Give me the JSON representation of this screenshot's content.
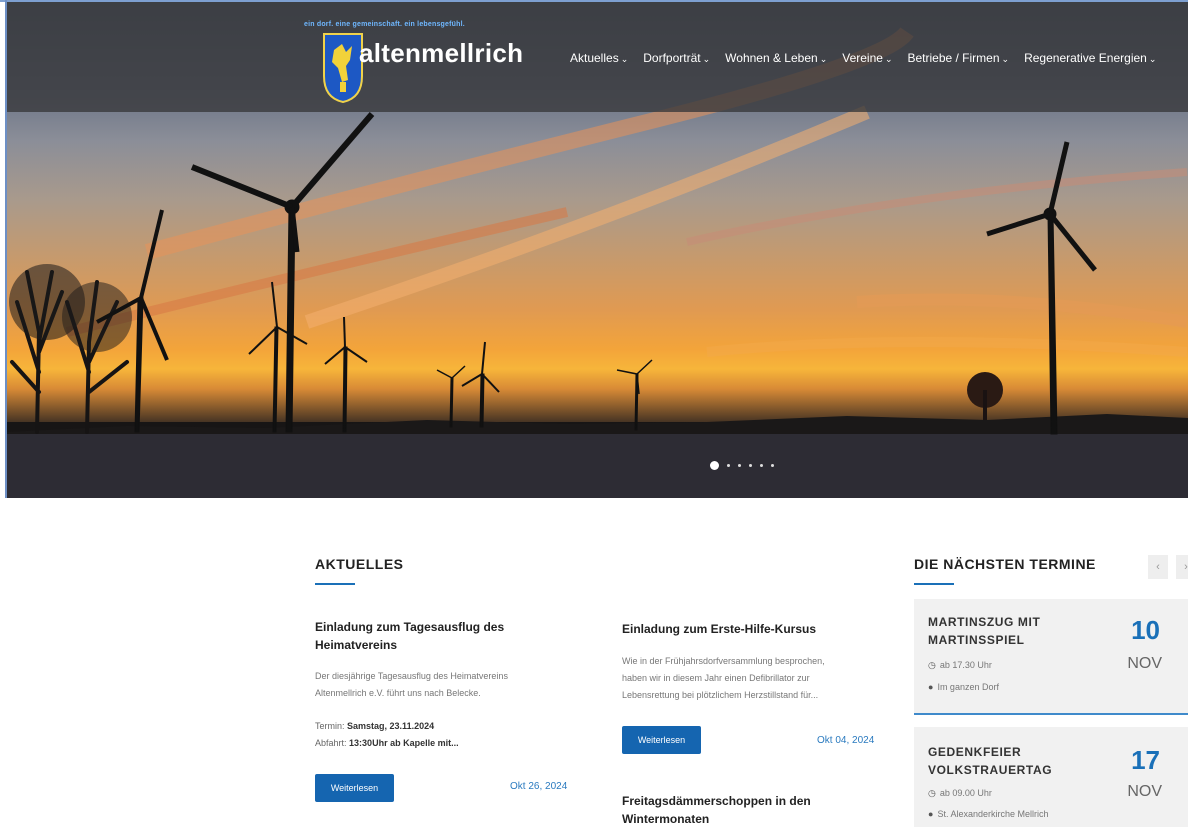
{
  "header": {
    "tagline": "ein dorf. eine gemeinschaft. ein lebensgefühl.",
    "brand": "altenmellrich",
    "nav": [
      {
        "label": "Aktuelles"
      },
      {
        "label": "Dorfporträt"
      },
      {
        "label": "Wohnen & Leben"
      },
      {
        "label": "Vereine"
      },
      {
        "label": "Betriebe / Firmen"
      },
      {
        "label": "Regenerative Energien"
      }
    ]
  },
  "slider": {
    "slide_count": 6,
    "active_index": 0
  },
  "aktuelles": {
    "title": "AKTUELLES",
    "articles": [
      {
        "title_line1": "Einladung zum Tagesausflug des",
        "title_line2": "Heimatvereins",
        "text_line1": "Der diesjährige Tagesausflug des Heimatvereins",
        "text_line2": "Altenmellrich e.V. führt uns nach Belecke.",
        "termin_label": "Termin:",
        "termin_value": "Samstag, 23.11.2024",
        "abfahrt_label": "Abfahrt:",
        "abfahrt_value": "13:30Uhr ab Kapelle mit...",
        "button": "Weiterlesen",
        "date": "Okt 26, 2024"
      },
      {
        "title_line1": "Einladung zum Erste-Hilfe-Kursus",
        "text_line1": "Wie in der Frühjahrsdorfversammlung besprochen,",
        "text_line2": "haben wir in diesem Jahr einen Defibrillator zur",
        "text_line3": "Lebensrettung bei plötzlichem Herzstillstand für...",
        "button": "Weiterlesen",
        "date": "Okt 04, 2024"
      },
      {
        "title_line1": "Freitagsdämmerschoppen in den",
        "title_line2": "Wintermonaten"
      }
    ]
  },
  "termine": {
    "title": "DIE NÄCHSTEN TERMINE",
    "prev_arrow": "‹",
    "next_arrow": "›",
    "events": [
      {
        "name_line1": "MARTINSZUG MIT",
        "name_line2": "MARTINSSPIEL",
        "time": "ab 17.30 Uhr",
        "place": "Im ganzen Dorf",
        "day": "10",
        "month": "NOV"
      },
      {
        "name_line1": "GEDENKFEIER",
        "name_line2": "VOLKSTRAUERTAG",
        "time": "ab 09.00 Uhr",
        "place": "St. Alexanderkirche Mellrich",
        "day": "17",
        "month": "NOV"
      }
    ]
  },
  "colors": {
    "accent": "#1565b0",
    "nav_bar": "#37373a",
    "link": "#2a7abf"
  }
}
